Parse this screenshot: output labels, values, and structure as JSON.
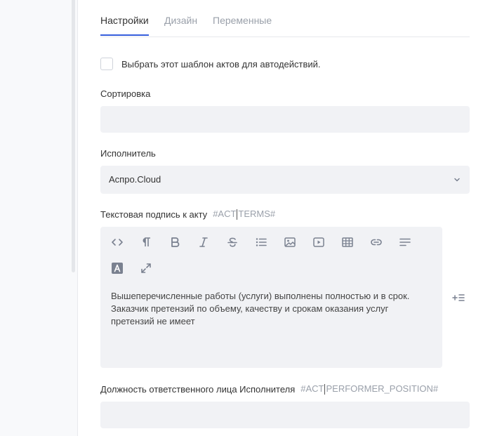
{
  "tabs": [
    {
      "label": "Настройки",
      "active": true
    },
    {
      "label": "Дизайн",
      "active": false
    },
    {
      "label": "Переменные",
      "active": false
    }
  ],
  "auto_template": {
    "label": "Выбрать этот шаблон актов для автодействий.",
    "checked": false
  },
  "sort": {
    "label": "Сортировка",
    "value": ""
  },
  "executor": {
    "label": "Исполнитель",
    "selected": "Аспро.Cloud"
  },
  "act_caption": {
    "label": "Текстовая подпись к акту",
    "code_before": "#ACT",
    "code_after": "TERMS#",
    "toolbar": [
      "code-view-icon",
      "paragraph-icon",
      "bold-icon",
      "italic-icon",
      "strikethrough-icon",
      "list-icon",
      "image-icon",
      "video-icon",
      "table-icon",
      "link-icon",
      "align-icon",
      "font-color-icon",
      "fullscreen-icon"
    ],
    "text_lines": [
      "Вышеперечисленные работы (услуги) выполнены полностью и в срок.",
      "Заказчик претензий по объему, качеству и срокам оказания услуг",
      "претензий не имеет"
    ]
  },
  "performer_position": {
    "label": "Должность ответственного лица Исполнителя",
    "code_before": "#ACT",
    "code_after": "PERFORMER_POSITION#",
    "value": ""
  },
  "colors": {
    "accent": "#365edc",
    "field_bg": "#f1f2f5",
    "muted": "#9aa0aa",
    "icon": "#7a8190"
  }
}
